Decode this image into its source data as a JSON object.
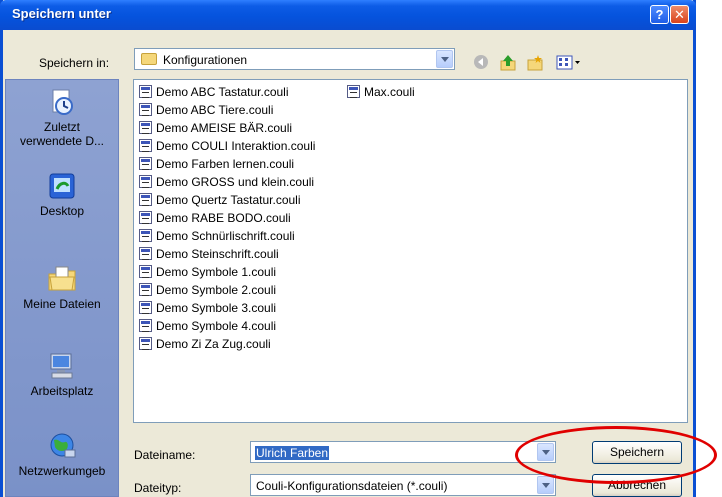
{
  "window": {
    "title": "Speichern unter",
    "help_glyph": "?",
    "close_glyph": "✕"
  },
  "location": {
    "label": "Speichern in:",
    "value": "Konfigurationen"
  },
  "toolbar": {
    "icons": [
      "back-icon",
      "up-folder-icon",
      "new-folder-icon",
      "view-menu-icon"
    ]
  },
  "places": [
    {
      "label_line1": "Zuletzt",
      "label_line2": "verwendete D...",
      "icon": "recent-documents-icon"
    },
    {
      "label_line1": "Desktop",
      "label_line2": "",
      "icon": "desktop-icon"
    },
    {
      "label_line1": "Meine Dateien",
      "label_line2": "",
      "icon": "my-documents-icon"
    },
    {
      "label_line1": "Arbeitsplatz",
      "label_line2": "",
      "icon": "my-computer-icon"
    },
    {
      "label_line1": "Netzwerkumgeb",
      "label_line2": "",
      "icon": "network-icon"
    }
  ],
  "files_col1": [
    "Demo ABC Tastatur.couli",
    "Demo ABC Tiere.couli",
    "Demo AMEISE BÄR.couli",
    "Demo COULI Interaktion.couli",
    "Demo Farben lernen.couli",
    "Demo GROSS und klein.couli",
    "Demo Quertz Tastatur.couli",
    "Demo RABE BODO.couli",
    "Demo Schnürlischrift.couli",
    "Demo Steinschrift.couli",
    "Demo Symbole 1.couli",
    "Demo Symbole 2.couli",
    "Demo Symbole 3.couli",
    "Demo Symbole 4.couli",
    "Demo Zi Za Zug.couli"
  ],
  "files_col2": [
    "Max.couli"
  ],
  "filename": {
    "label": "Dateiname:",
    "value": "Ulrich Farben"
  },
  "filetype": {
    "label": "Dateityp:",
    "value": "Couli-Konfigurationsdateien (*.couli)"
  },
  "buttons": {
    "save": "Speichern",
    "cancel": "Abbrechen"
  },
  "colors": {
    "annotation_oval": "#e00000",
    "selection": "#316ac5",
    "title_bar": "#0553dd"
  }
}
